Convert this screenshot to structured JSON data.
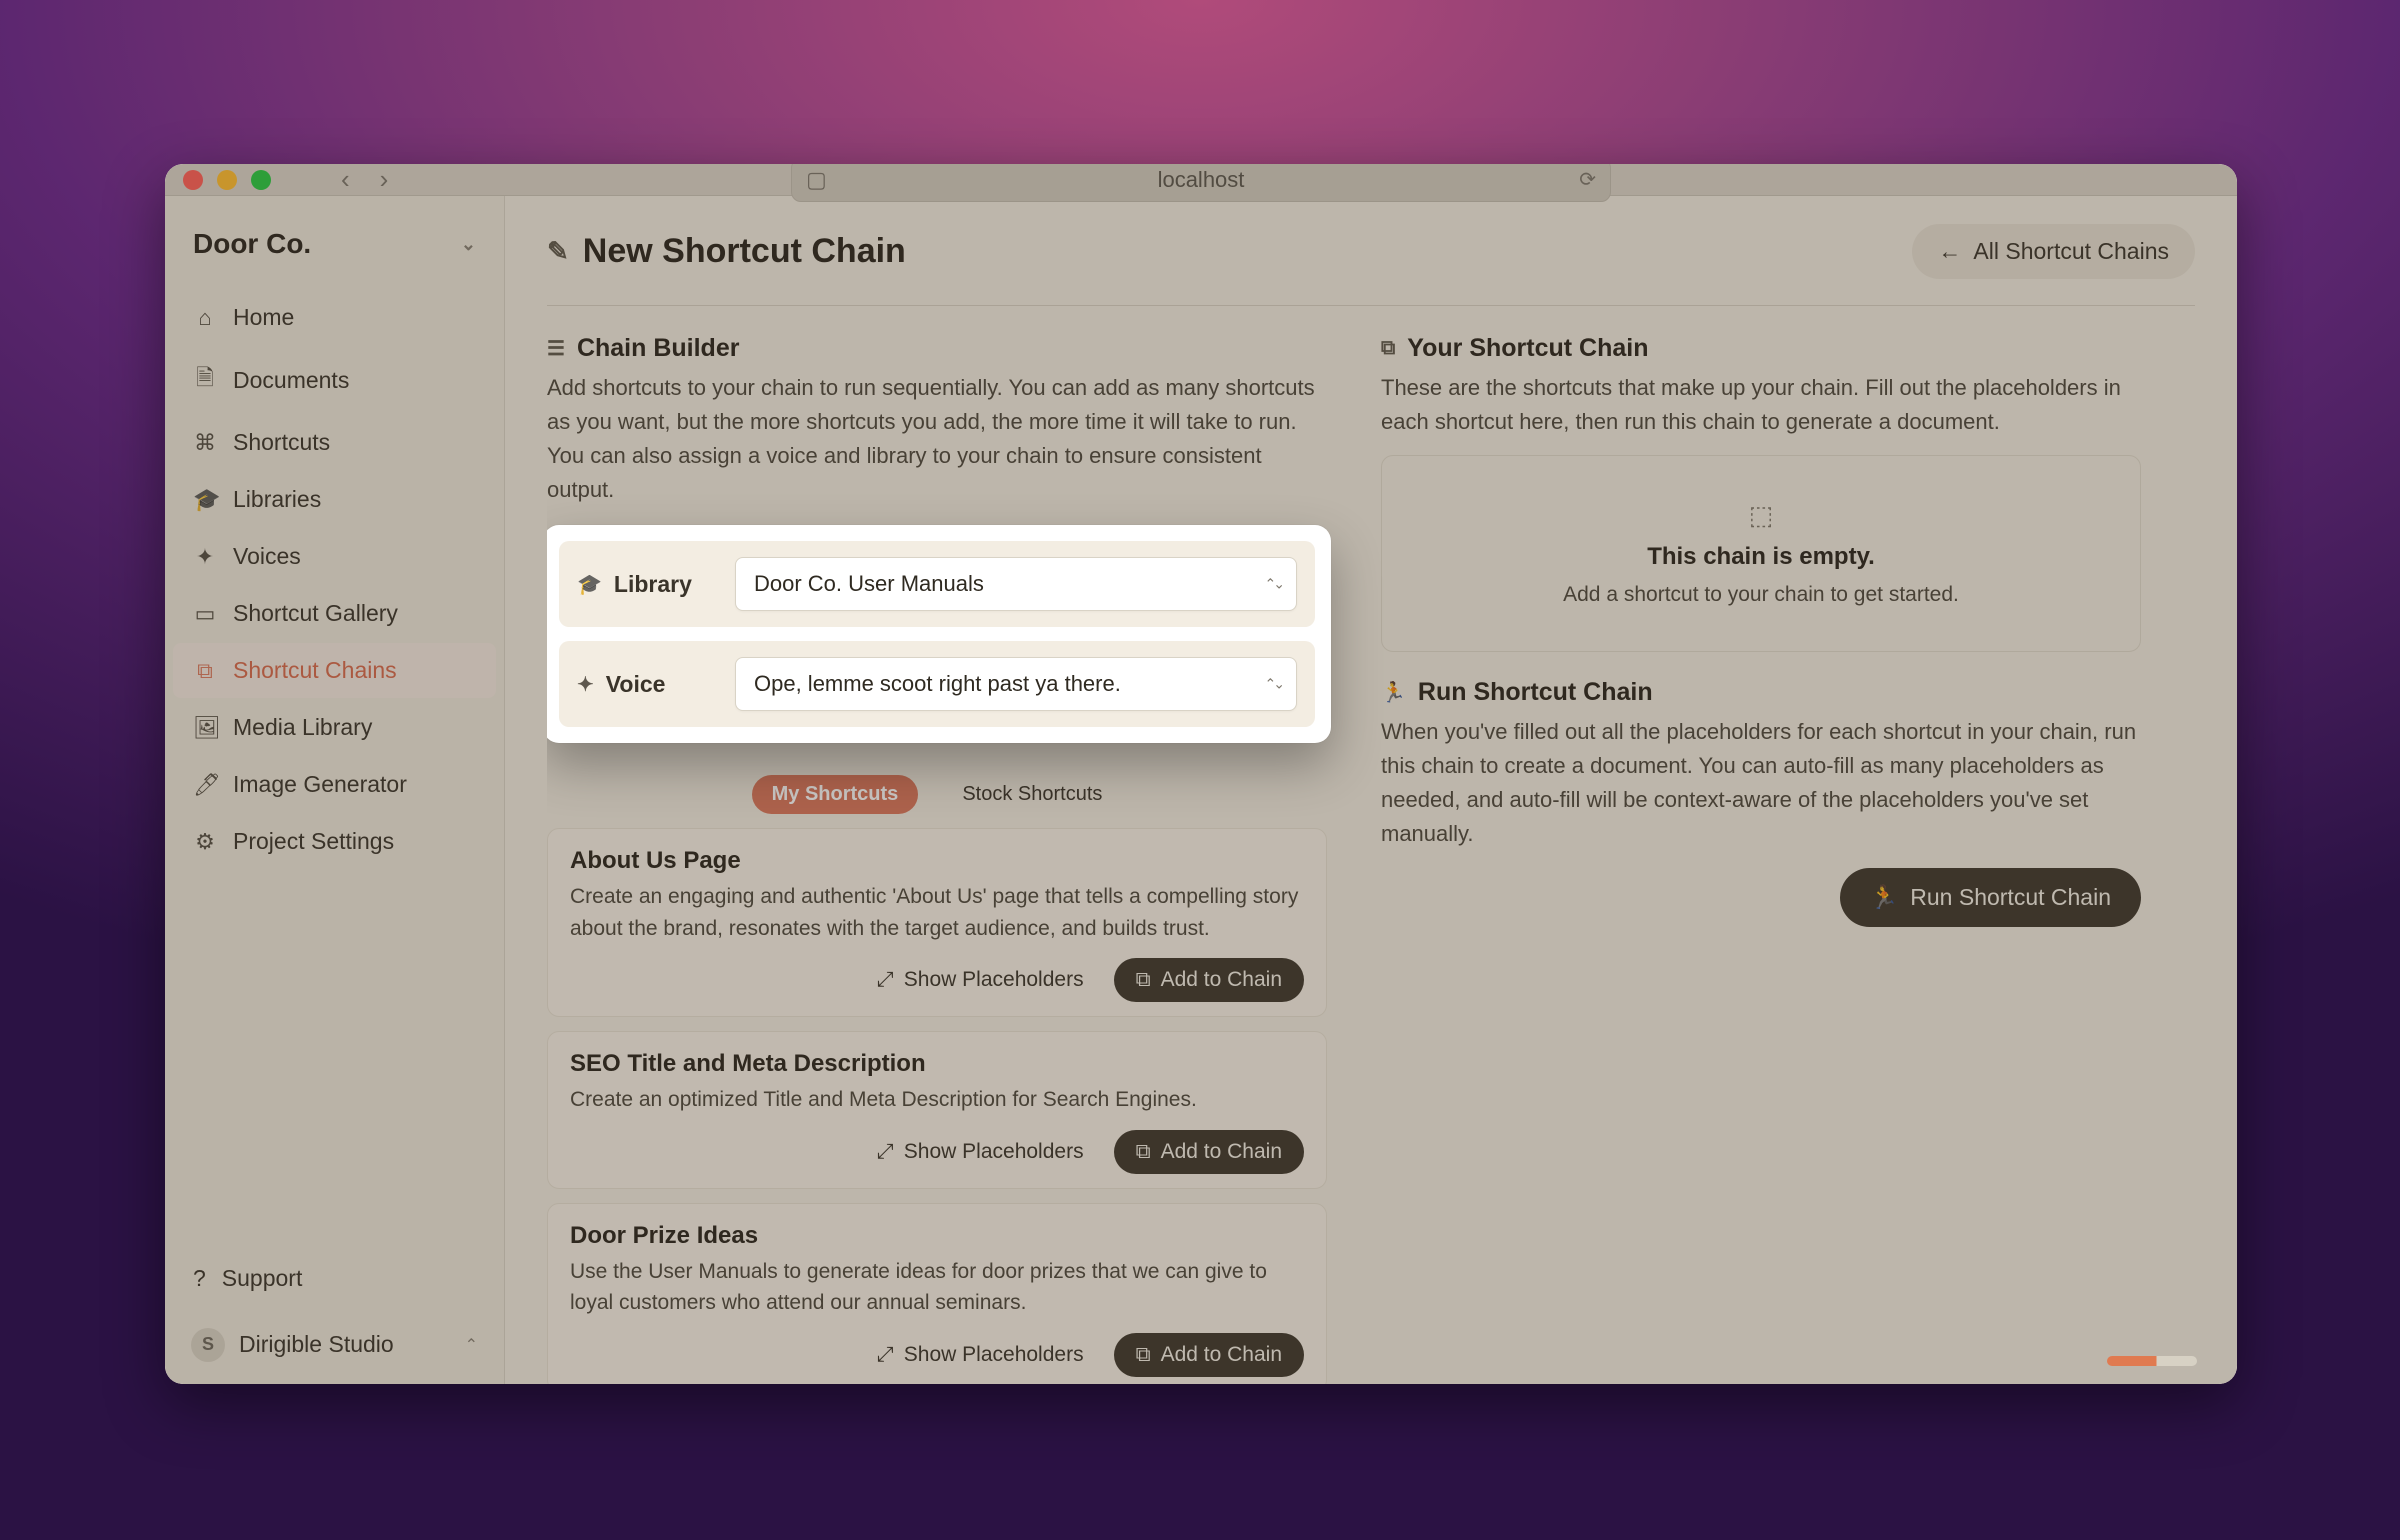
{
  "browser": {
    "url": "localhost"
  },
  "workspace": {
    "name": "Door Co."
  },
  "sidebar": {
    "items": [
      {
        "icon": "home-icon",
        "glyph": "⌂",
        "label": "Home"
      },
      {
        "icon": "documents-icon",
        "glyph": "🗎",
        "label": "Documents"
      },
      {
        "icon": "shortcuts-icon",
        "glyph": "⌘",
        "label": "Shortcuts"
      },
      {
        "icon": "libraries-icon",
        "glyph": "🎓",
        "label": "Libraries"
      },
      {
        "icon": "voices-icon",
        "glyph": "✦",
        "label": "Voices"
      },
      {
        "icon": "shortcut-gallery-icon",
        "glyph": "▭",
        "label": "Shortcut Gallery"
      },
      {
        "icon": "shortcut-chains-icon",
        "glyph": "⧉",
        "label": "Shortcut Chains"
      },
      {
        "icon": "media-library-icon",
        "glyph": "🖼",
        "label": "Media Library"
      },
      {
        "icon": "image-generator-icon",
        "glyph": "🖊",
        "label": "Image Generator"
      },
      {
        "icon": "project-settings-icon",
        "glyph": "⚙",
        "label": "Project Settings"
      }
    ],
    "support_label": "Support",
    "account": {
      "initial": "S",
      "name": "Dirigible Studio"
    }
  },
  "page": {
    "title": "New Shortcut Chain",
    "all_chains_label": "All Shortcut Chains"
  },
  "builder": {
    "heading": "Chain Builder",
    "desc": "Add shortcuts to your chain to run sequentially. You can add as many shortcuts as you want, but the more shortcuts you add, the more time it will take to run. You can also assign a voice and library to your chain to ensure consistent output.",
    "library_label": "Library",
    "library_value": "Door Co. User Manuals",
    "voice_label": "Voice",
    "voice_value": "Ope, lemme scoot right past ya there.",
    "tabs": {
      "mine": "My Shortcuts",
      "stock": "Stock Shortcuts"
    },
    "show_placeholders": "Show Placeholders",
    "add_to_chain": "Add to Chain",
    "cards": [
      {
        "title": "About Us Page",
        "desc": "Create an engaging and authentic 'About Us' page that tells a compelling story about the brand, resonates with the target audience, and builds trust."
      },
      {
        "title": "SEO Title and Meta Description",
        "desc": "Create an optimized Title and Meta Description for Search Engines."
      },
      {
        "title": "Door Prize Ideas",
        "desc": "Use the User Manuals to generate ideas for door prizes that we can give to loyal customers who attend our annual seminars."
      }
    ]
  },
  "chain": {
    "heading": "Your Shortcut Chain",
    "desc": "These are the shortcuts that make up your chain. Fill out the placeholders in each shortcut here, then run this chain to generate a document.",
    "empty_title": "This chain is empty.",
    "empty_sub": "Add a shortcut to your chain to get started."
  },
  "run": {
    "heading": "Run Shortcut Chain",
    "desc": "When you've filled out all the placeholders for each shortcut in your chain, run this chain to create a document. You can auto-fill as many placeholders as needed, and auto-fill will be context-aware of the placeholders you've set manually.",
    "button": "Run Shortcut Chain"
  }
}
